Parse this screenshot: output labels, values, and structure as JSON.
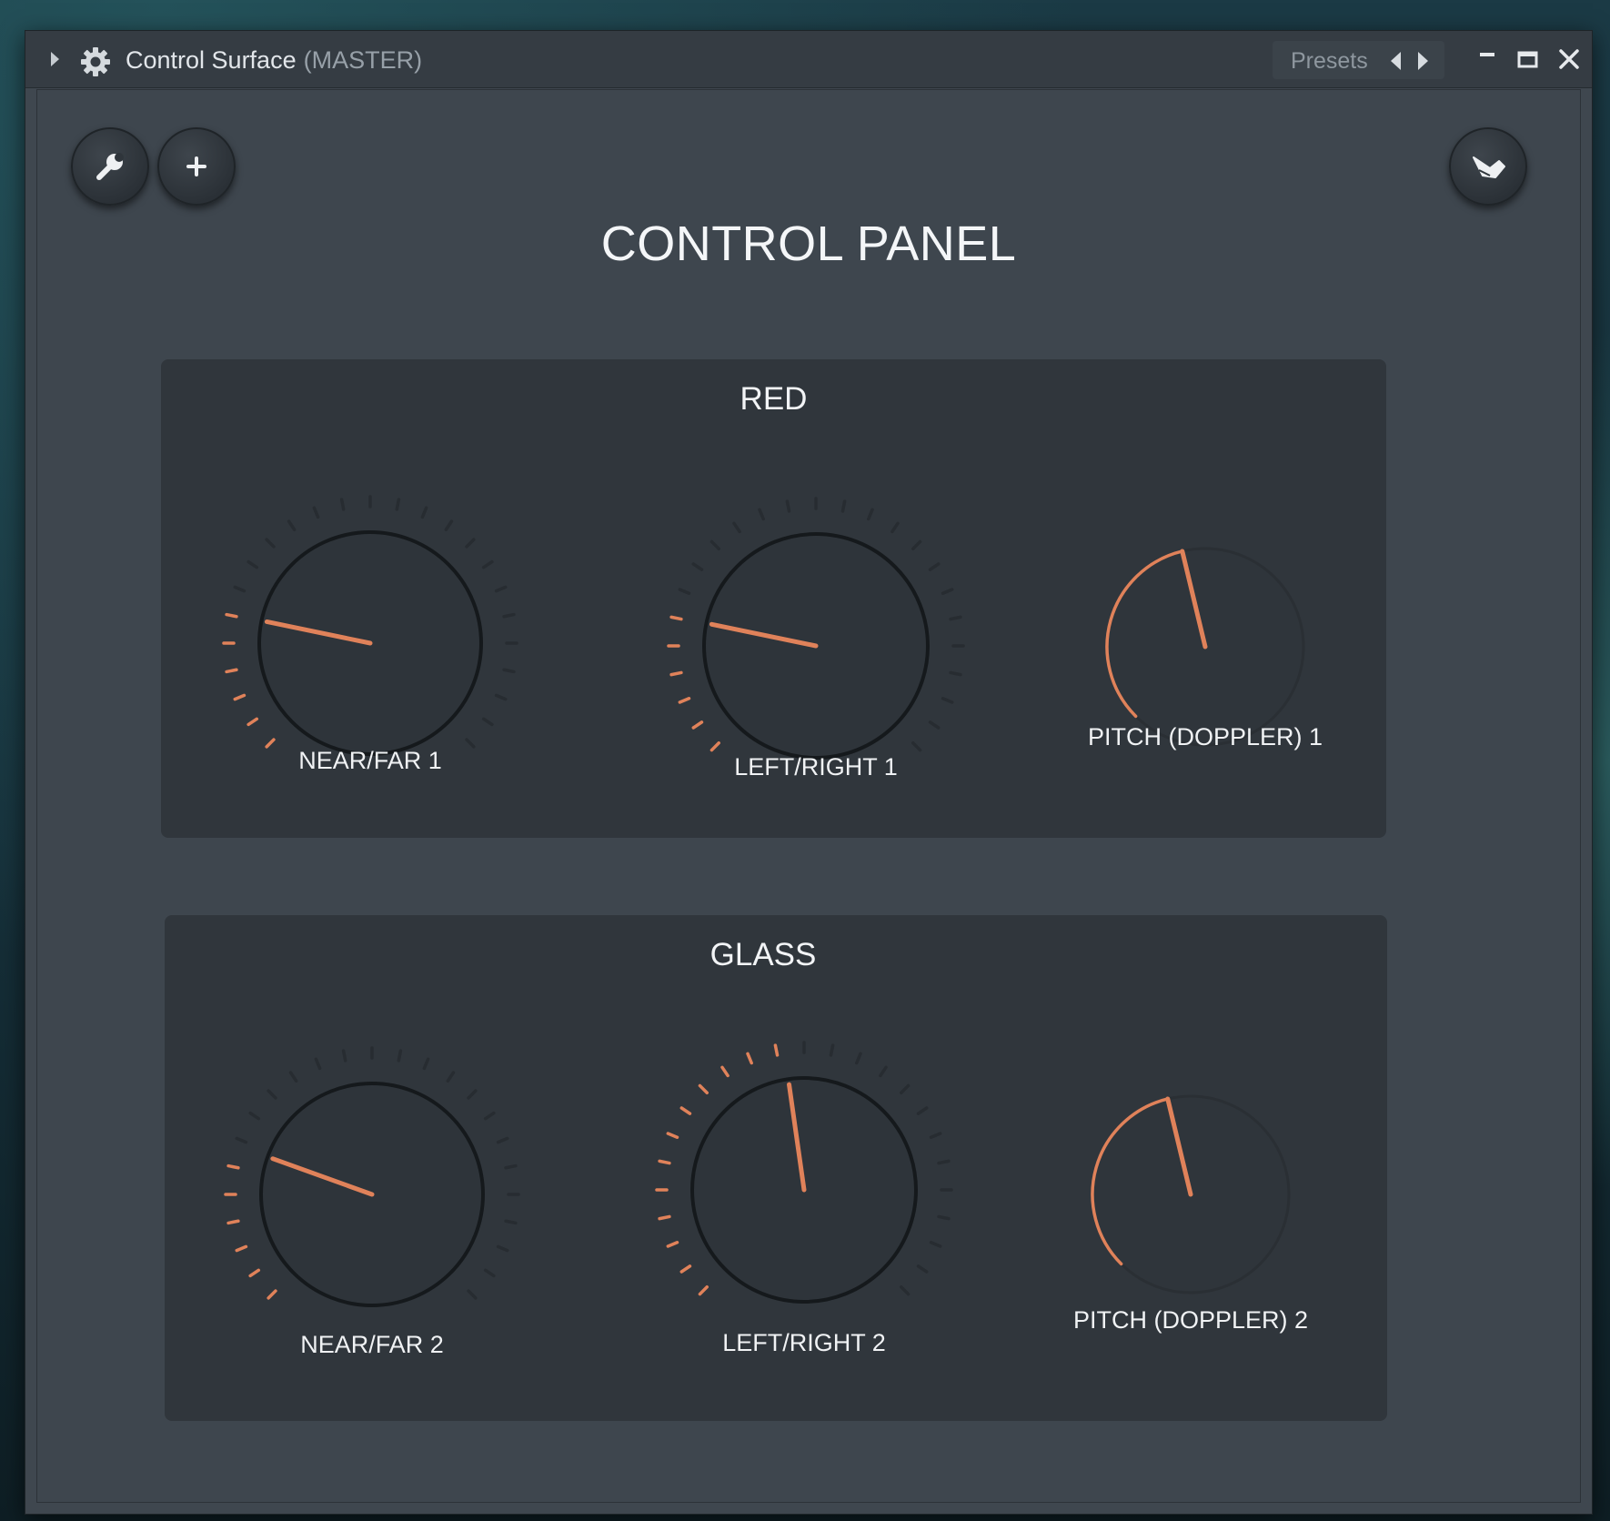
{
  "window": {
    "title": "Control Surface",
    "subtitle": "(MASTER)",
    "presets_label": "Presets"
  },
  "toolbar": {
    "wrench_icon": "wrench-icon",
    "add_icon": "plus-icon",
    "hand_icon": "hand-icon"
  },
  "panel": {
    "title": "CONTROL PANEL",
    "groups": [
      {
        "title": "RED",
        "knobs": [
          {
            "label": "NEAR/FAR 1",
            "value": 0.21,
            "style": "ticked"
          },
          {
            "label": "LEFT/RIGHT 1",
            "value": 0.21,
            "style": "ticked"
          },
          {
            "label": "PITCH (DOPPLER) 1",
            "value": 0.45,
            "style": "arc"
          }
        ]
      },
      {
        "title": "GLASS",
        "knobs": [
          {
            "label": "NEAR/FAR 2",
            "value": 0.24,
            "style": "ticked"
          },
          {
            "label": "LEFT/RIGHT 2",
            "value": 0.47,
            "style": "ticked"
          },
          {
            "label": "PITCH (DOPPLER) 2",
            "value": 0.45,
            "style": "arc"
          }
        ]
      }
    ]
  },
  "colors": {
    "accent": "#e0825a",
    "tick_inactive": "#272c31",
    "knob_body": "#2e343a",
    "knob_border": "#15191c"
  }
}
